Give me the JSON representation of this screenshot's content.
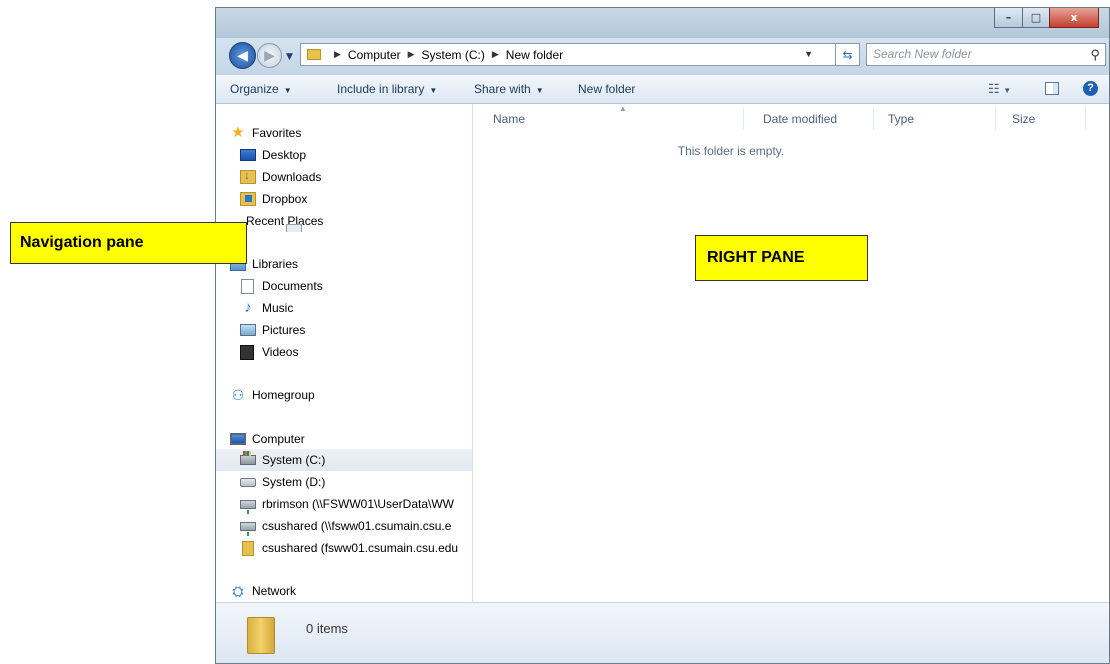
{
  "window": {
    "controls": {
      "minimize": "–",
      "maximize": "□",
      "close": "x"
    }
  },
  "address_bar": {
    "back_icon": "back-arrow-icon",
    "forward_icon": "forward-arrow-icon",
    "crumbs": [
      "Computer",
      "System (C:)",
      "New folder"
    ],
    "search_placeholder": "Search New folder"
  },
  "toolbar": {
    "organize": "Organize",
    "include_in_library": "Include in library",
    "share_with": "Share with",
    "new_folder": "New folder"
  },
  "navigation": {
    "favorites": {
      "label": "Favorites",
      "items": [
        {
          "label": "Desktop",
          "icon": "desktop-icon"
        },
        {
          "label": "Downloads",
          "icon": "downloads-icon"
        },
        {
          "label": "Dropbox",
          "icon": "dropbox-icon"
        },
        {
          "label": "Recent Places",
          "icon": "recent-places-icon"
        }
      ]
    },
    "libraries": {
      "label": "Libraries",
      "items": [
        {
          "label": "Documents",
          "icon": "documents-icon"
        },
        {
          "label": "Music",
          "icon": "music-icon"
        },
        {
          "label": "Pictures",
          "icon": "pictures-icon"
        },
        {
          "label": "Videos",
          "icon": "videos-icon"
        }
      ]
    },
    "homegroup": {
      "label": "Homegroup"
    },
    "computer": {
      "label": "Computer",
      "items": [
        {
          "label": "System (C:)",
          "icon": "drive-c-icon",
          "selected": true
        },
        {
          "label": "System (D:)",
          "icon": "drive-d-icon"
        },
        {
          "label": "rbrimson (\\\\FSWW01\\UserData\\WW",
          "icon": "network-drive-icon"
        },
        {
          "label": "csushared (\\\\fsww01.csumain.csu.e",
          "icon": "network-drive-icon"
        },
        {
          "label": "csushared (fsww01.csumain.csu.edu",
          "icon": "network-folder-icon"
        }
      ]
    },
    "network": {
      "label": "Network"
    }
  },
  "content": {
    "columns": [
      "Name",
      "Date modified",
      "Type",
      "Size"
    ],
    "empty_message": "This folder is empty."
  },
  "status": {
    "items": "0 items"
  },
  "callouts": {
    "navigation_pane": "Navigation pane",
    "right_pane": "RIGHT PANE"
  },
  "colors": {
    "callout_bg": "#ffff00",
    "selection_bg": "#e5ebf2",
    "toolbar_text": "#1e395b"
  }
}
